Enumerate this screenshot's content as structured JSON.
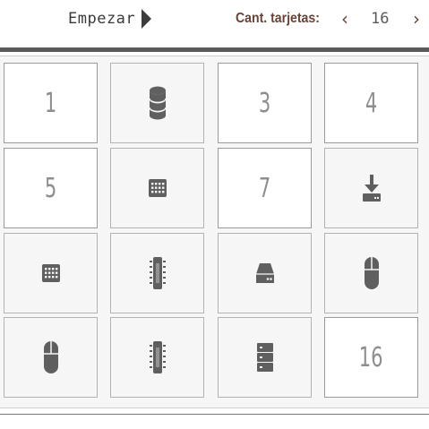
{
  "header": {
    "start_label": "Empezar",
    "count_label": "Cant. tarjetas:",
    "count_value": "16",
    "prev_icon": "chevron-left-icon",
    "next_icon": "chevron-right-icon"
  },
  "colors": {
    "accent": "#6a4336",
    "icon": "#5f5f5f",
    "number": "#8e8e8e"
  },
  "cards": [
    {
      "type": "number",
      "label": "1"
    },
    {
      "type": "icon",
      "icon": "database-icon"
    },
    {
      "type": "number",
      "label": "3"
    },
    {
      "type": "number",
      "label": "4"
    },
    {
      "type": "number",
      "label": "5"
    },
    {
      "type": "icon",
      "icon": "keyboard-icon"
    },
    {
      "type": "number",
      "label": "7"
    },
    {
      "type": "icon",
      "icon": "download-icon"
    },
    {
      "type": "icon",
      "icon": "keyboard-icon"
    },
    {
      "type": "icon",
      "icon": "chip-icon"
    },
    {
      "type": "icon",
      "icon": "hard-drive-icon"
    },
    {
      "type": "icon",
      "icon": "mouse-icon"
    },
    {
      "type": "icon",
      "icon": "mouse-icon"
    },
    {
      "type": "icon",
      "icon": "chip-icon"
    },
    {
      "type": "icon",
      "icon": "server-icon"
    },
    {
      "type": "number",
      "label": "16"
    }
  ]
}
